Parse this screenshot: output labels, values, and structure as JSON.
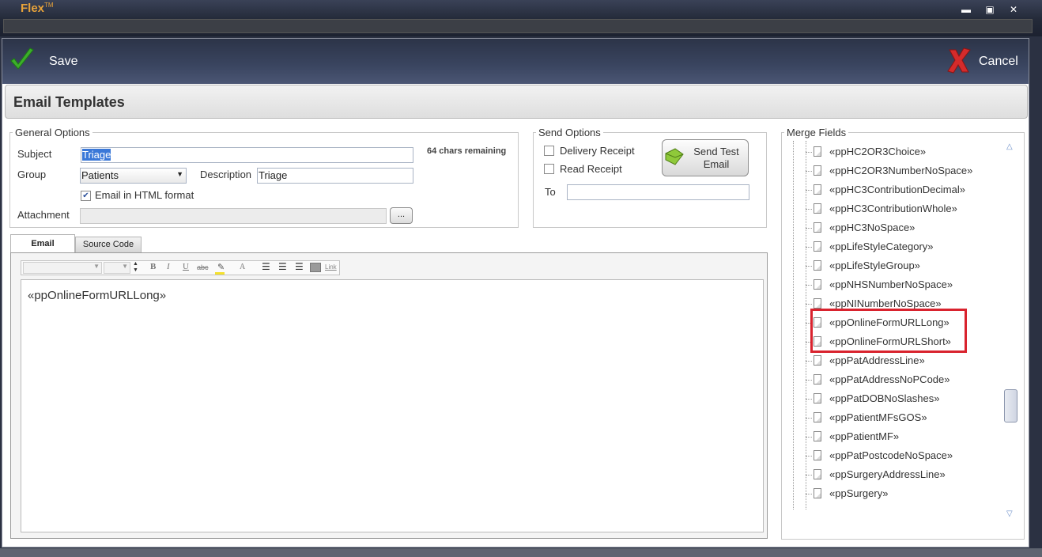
{
  "app": {
    "title": "Flex",
    "trademark": "TM"
  },
  "window_controls": {
    "minimize": "▬",
    "maximize": "▣",
    "close": "✕"
  },
  "toolbar": {
    "save_label": "Save",
    "cancel_label": "Cancel"
  },
  "section_title": "Email Templates",
  "general_options": {
    "legend": "General Options",
    "subject_label": "Subject",
    "subject_value": "Triage",
    "chars_remaining": "64 chars remaining",
    "group_label": "Group",
    "group_value": "Patients",
    "description_label": "Description",
    "description_value": "Triage",
    "html_format_label": "Email in HTML format",
    "html_format_checked": true,
    "attachment_label": "Attachment",
    "attachment_value": "",
    "browse_label": "..."
  },
  "send_options": {
    "legend": "Send Options",
    "delivery_receipt_label": "Delivery Receipt",
    "read_receipt_label": "Read Receipt",
    "to_label": "To",
    "to_value": "",
    "send_test_label_line1": "Send Test",
    "send_test_label_line2": "Email"
  },
  "editor": {
    "tabs": [
      "Email",
      "Source Code"
    ],
    "active_tab": "Email",
    "format_buttons": {
      "bold": "B",
      "italic": "I",
      "underline": "U",
      "strike": "abc",
      "font_color": "A",
      "link": "Link"
    },
    "body_text": "«ppOnlineFormURLLong»"
  },
  "merge_fields": {
    "legend": "Merge Fields",
    "items": [
      "«ppHC2OR3Choice»",
      "«ppHC2OR3NumberNoSpace»",
      "«ppHC3ContributionDecimal»",
      "«ppHC3ContributionWhole»",
      "«ppHC3NoSpace»",
      "«ppLifeStyleCategory»",
      "«ppLifeStyleGroup»",
      "«ppNHSNumberNoSpace»",
      "«ppNINumberNoSpace»",
      "«ppOnlineFormURLLong»",
      "«ppOnlineFormURLShort»",
      "«ppPatAddressLine»",
      "«ppPatAddressNoPCode»",
      "«ppPatDOBNoSlashes»",
      "«ppPatientMFsGOS»",
      "«ppPatientMF»",
      "«ppPatPostcodeNoSpace»",
      "«ppSurgeryAddressLine»",
      "«ppSurgery»"
    ],
    "highlighted": [
      "«ppOnlineFormURLLong»",
      "«ppOnlineFormURLShort»"
    ]
  },
  "colors": {
    "accent": "#e8a33a",
    "highlight": "#d9232e",
    "save_green": "#3cae2a",
    "cancel_red": "#d42b2b"
  }
}
